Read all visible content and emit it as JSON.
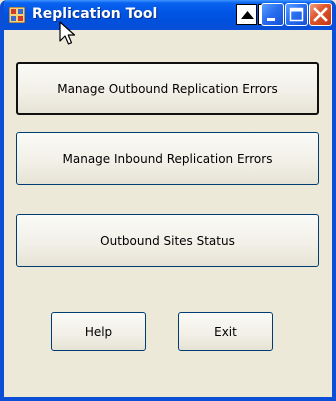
{
  "window": {
    "title": "Replication Tool",
    "icons": {
      "app": "app-grid-icon",
      "cursor": "mouse-pointer-icon",
      "move_up": "triangle-up-icon",
      "pin": "pin-icon",
      "minimize": "minimize-icon",
      "maximize": "maximize-icon",
      "close": "close-icon"
    }
  },
  "buttons": {
    "outbound_errors": "Manage Outbound Replication Errors",
    "inbound_errors": "Manage Inbound Replication Errors",
    "sites_status": "Outbound Sites Status",
    "help": "Help",
    "exit": "Exit"
  },
  "colors": {
    "titlebar": "#0055e5",
    "window_bg": "#ece9d8",
    "close_button": "#e0582e"
  }
}
